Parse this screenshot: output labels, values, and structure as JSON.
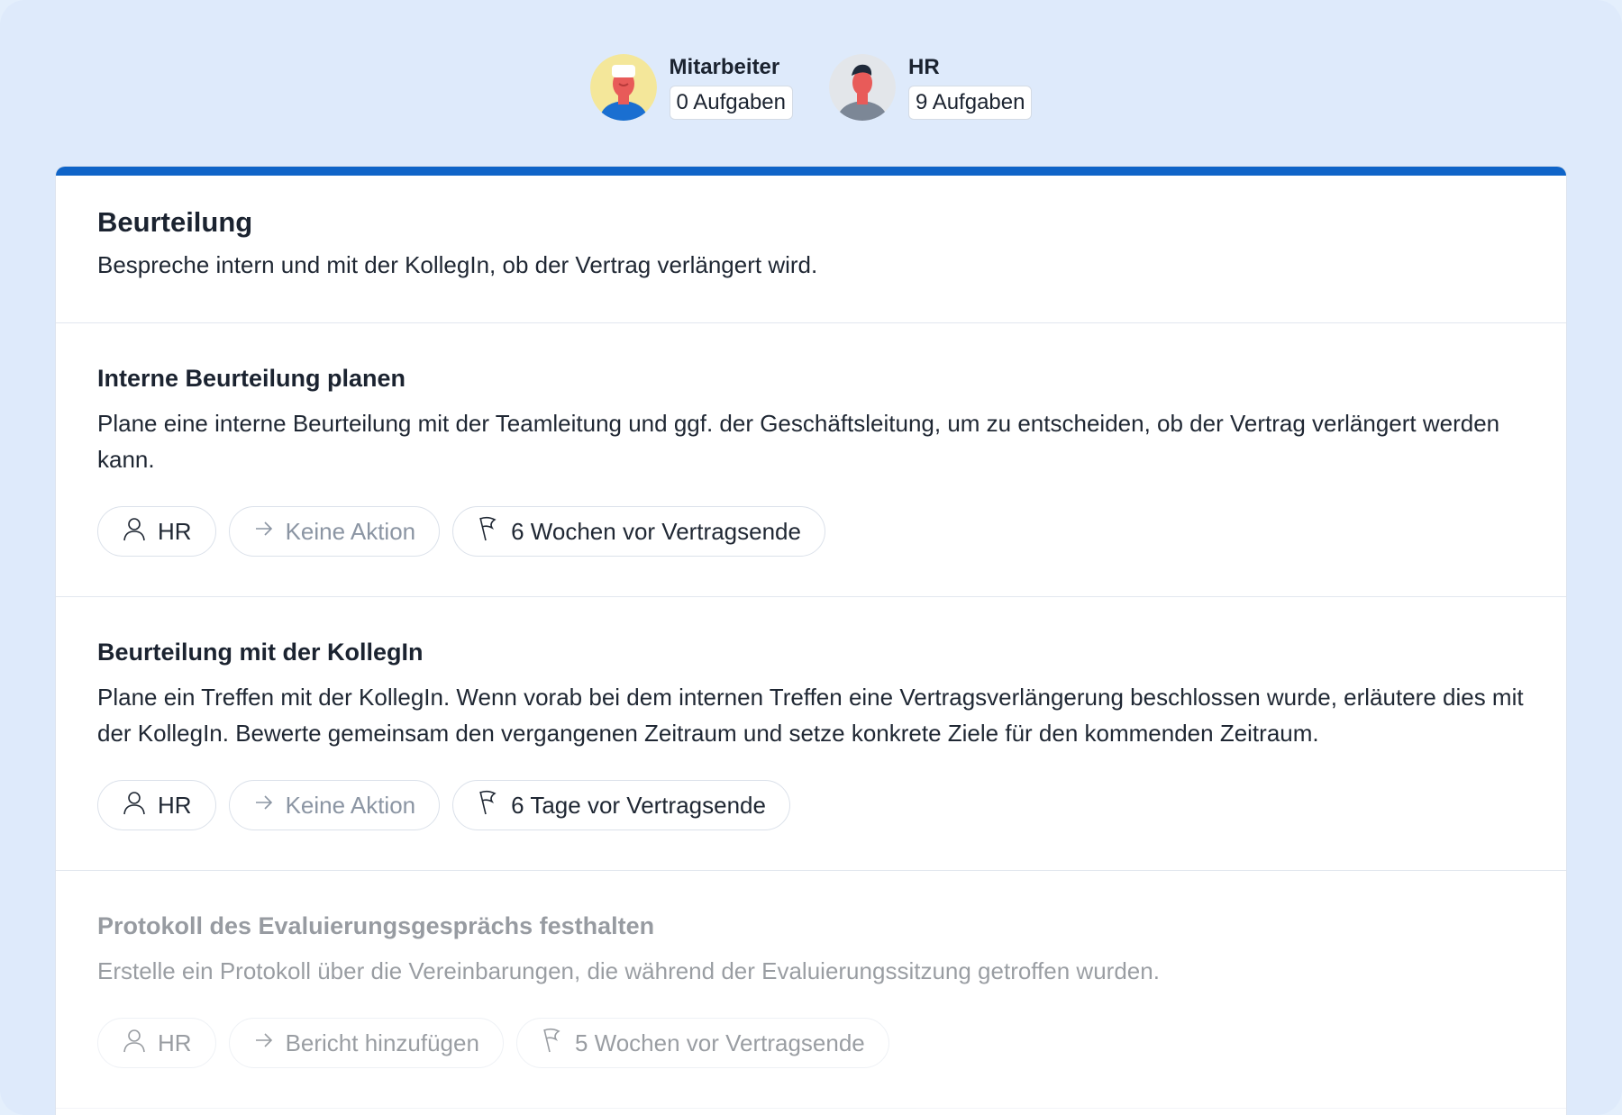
{
  "participants": [
    {
      "name": "Mitarbeiter",
      "tasks": "0 Aufgaben"
    },
    {
      "name": "HR",
      "tasks": "9 Aufgaben"
    }
  ],
  "section": {
    "title": "Beurteilung",
    "description": "Bespreche intern und mit der KollegIn, ob der Vertrag verlängert wird."
  },
  "tasks": [
    {
      "title": "Interne Beurteilung planen",
      "description": "Plane eine interne Beurteilung mit der Teamleitung und ggf. der Geschäftsleitung, um zu entscheiden, ob der Vertrag verlängert werden kann.",
      "assignee": "HR",
      "action": "Keine Aktion",
      "due": "6 Wochen vor Vertragsende"
    },
    {
      "title": "Beurteilung mit der KollegIn",
      "description": "Plane ein Treffen mit der KollegIn. Wenn vorab bei dem internen Treffen eine Vertragsverlängerung beschlossen wurde, erläutere dies mit der KollegIn. Bewerte gemeinsam den vergangenen Zeitraum und setze konkrete Ziele für den kommenden Zeitraum.",
      "assignee": "HR",
      "action": "Keine Aktion",
      "due": "6 Tage vor Vertragsende"
    },
    {
      "title": "Protokoll des Evaluierungsgesprächs festhalten",
      "description": "Erstelle ein Protokoll über die Vereinbarungen, die während der Evaluierungssitzung getroffen wurden.",
      "assignee": "HR",
      "action": "Bericht hinzufügen",
      "due": "5 Wochen vor Vertragsende"
    }
  ],
  "colors": {
    "accent": "#0f64c8",
    "background": "#deeafb",
    "muted_text": "#8b95a3"
  },
  "icons": [
    "person-icon",
    "arrow-right-icon",
    "flag-icon"
  ]
}
